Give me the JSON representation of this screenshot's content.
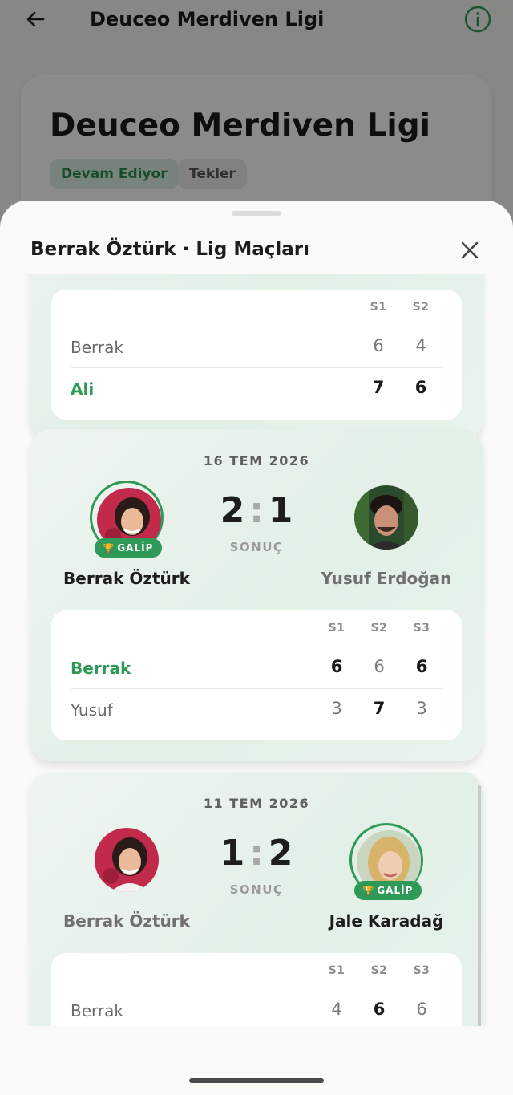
{
  "topbar": {
    "title": "Deuceo Merdiven Ligi"
  },
  "league": {
    "title": "Deuceo Merdiven Ligi",
    "status_chip": "Devam Ediyor",
    "type_chip": "Tekler"
  },
  "sheet": {
    "title": "Berrak Öztürk · Lig Maçları",
    "score_label": "SONUÇ",
    "winner_badge": "GALİP"
  },
  "matches": [
    {
      "date": "",
      "sets_header": [
        "S1",
        "S2"
      ],
      "rows": [
        {
          "name": "Berrak",
          "values": [
            "6",
            "4"
          ]
        },
        {
          "name": "Ali",
          "values": [
            "7",
            "6"
          ]
        }
      ]
    },
    {
      "date": "16 TEM 2026",
      "player_left": "Berrak Öztürk",
      "player_right": "Yusuf Erdoğan",
      "score_left": "2",
      "score_right": "1",
      "winner": "left",
      "sets_header": [
        "S1",
        "S2",
        "S3"
      ],
      "rows": [
        {
          "name": "Berrak",
          "values": [
            "6",
            "6",
            "6"
          ]
        },
        {
          "name": "Yusuf",
          "values": [
            "3",
            "7",
            "3"
          ]
        }
      ]
    },
    {
      "date": "11 TEM 2026",
      "player_left": "Berrak Öztürk",
      "player_right": "Jale Karadağ",
      "score_left": "1",
      "score_right": "2",
      "winner": "right",
      "sets_header": [
        "S1",
        "S2",
        "S3"
      ],
      "rows": [
        {
          "name": "Berrak",
          "values": [
            "4",
            "6",
            "6"
          ]
        }
      ]
    }
  ],
  "colors": {
    "accent": "#2f9a57",
    "card_bg": "#e6f2e9",
    "sheet_bg": "#fafaf6"
  }
}
